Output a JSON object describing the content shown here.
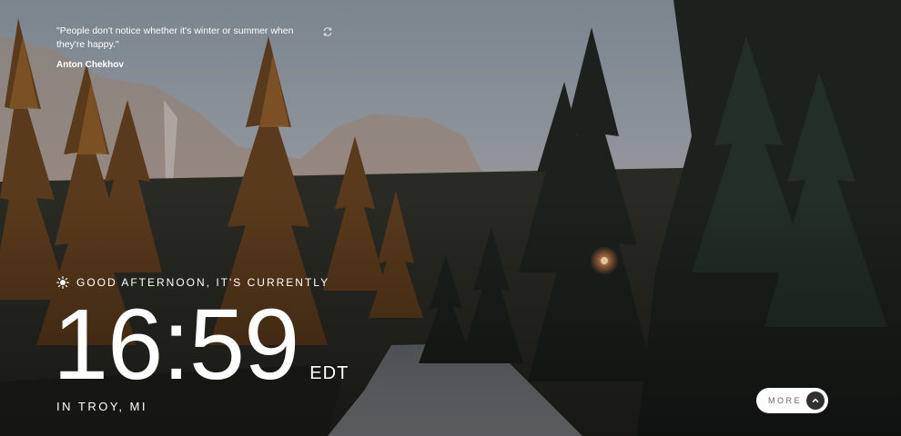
{
  "quote": {
    "text": "\"People don't notice whether it's winter or summer when they're happy.\"",
    "author": "Anton Chekhov",
    "refresh_icon": "refresh-icon"
  },
  "greeting": {
    "icon": "sun-icon",
    "text": "GOOD AFTERNOON, IT'S CURRENTLY"
  },
  "clock": {
    "time": "16:59",
    "timezone": "EDT"
  },
  "location": {
    "text": "IN TROY, MI"
  },
  "more_button": {
    "label": "MORE",
    "icon": "chevron-up-icon"
  },
  "colors": {
    "text": "#ffffff",
    "button_bg": "#ffffff",
    "button_icon_bg": "#303030"
  }
}
